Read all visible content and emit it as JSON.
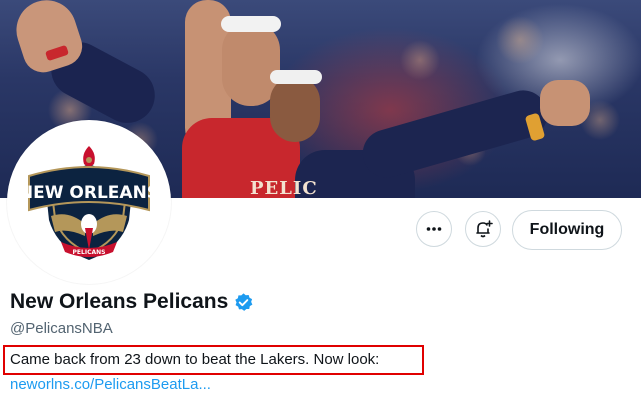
{
  "banner": {
    "jersey_text": "PELIC",
    "logo_text_top": "NEW ORLEANS",
    "logo_text_bottom": "PELICANS"
  },
  "actions": {
    "more_icon": "ellipsis-icon",
    "notify_icon": "bell-plus-icon",
    "follow_label": "Following"
  },
  "profile": {
    "display_name": "New Orleans Pelicans",
    "verified_icon": "verified-badge-icon",
    "handle": "@PelicansNBA",
    "bio": "Came back from 23 down to beat the Lakers. Now look:",
    "link": "neworlns.co/PelicansBeatLa..."
  },
  "colors": {
    "accent_blue": "#1d9bf0",
    "highlight_red": "#e00000",
    "pelicans_navy": "#0c2340",
    "pelicans_gold": "#b4975a",
    "pelicans_red": "#c8102e"
  }
}
